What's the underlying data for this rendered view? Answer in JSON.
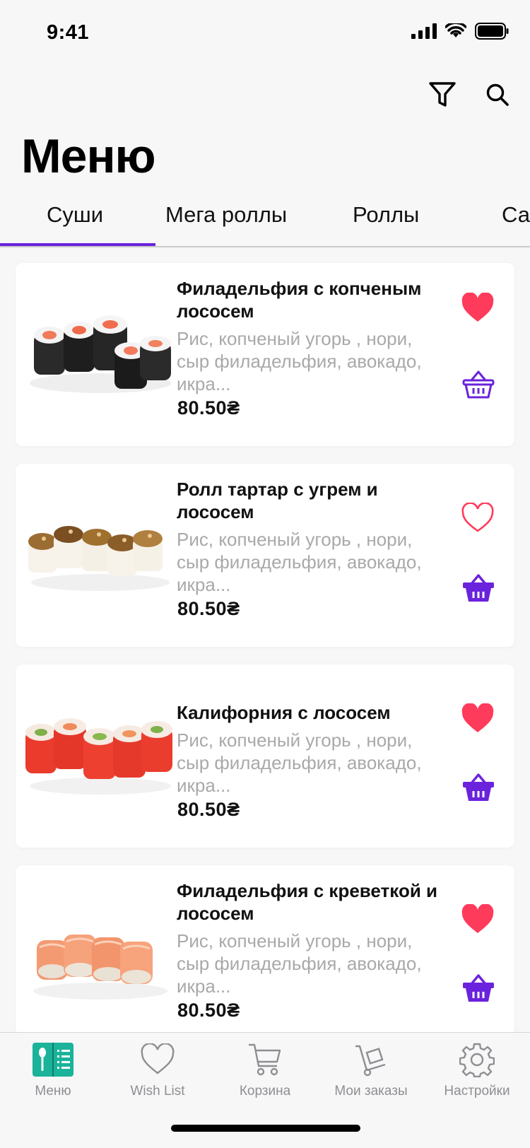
{
  "status_bar": {
    "time": "9:41"
  },
  "toolbar": {
    "filter_icon": "filter-icon",
    "search_icon": "search-icon"
  },
  "page": {
    "title": "Меню"
  },
  "tabs": [
    {
      "label": "Суши",
      "active": true
    },
    {
      "label": "Мега роллы",
      "active": false
    },
    {
      "label": "Роллы",
      "active": false
    },
    {
      "label": "Са",
      "active": false
    }
  ],
  "products": [
    {
      "title": "Филадельфия с копченым лососем",
      "description": "Рис, копченый угорь , нори, сыр филадельфия, авокадо, икра...",
      "price": "80.50₴",
      "favorite": true,
      "basket_style": "outline"
    },
    {
      "title": "Ролл тартар с угрем и лососем",
      "description": "Рис, копченый угорь , нори, сыр филадельфия, авокадо, икра...",
      "price": "80.50₴",
      "favorite": false,
      "basket_style": "filled"
    },
    {
      "title": "Калифорния с лососем",
      "description": "Рис, копченый угорь , нори, сыр филадельфия, авокадо, икра...",
      "price": "80.50₴",
      "favorite": true,
      "basket_style": "filled"
    },
    {
      "title": "Филадельфия с креветкой и лососем",
      "description": "Рис, копченый угорь , нори, сыр филадельфия, авокадо, икра...",
      "price": "80.50₴",
      "favorite": true,
      "basket_style": "filled"
    }
  ],
  "tabbar": [
    {
      "label": "Меню",
      "icon": "menu-book-icon",
      "active": true
    },
    {
      "label": "Wish List",
      "icon": "heart-outline-icon",
      "active": false
    },
    {
      "label": "Корзина",
      "icon": "cart-icon",
      "active": false
    },
    {
      "label": "Мои заказы",
      "icon": "hand-truck-icon",
      "active": false
    },
    {
      "label": "Настройки",
      "icon": "gear-icon",
      "active": false
    }
  ],
  "colors": {
    "accent": "#6a22dc",
    "heart": "#ff3b5c",
    "menu_active": "#1bb39a",
    "muted": "#a9a9a9"
  }
}
